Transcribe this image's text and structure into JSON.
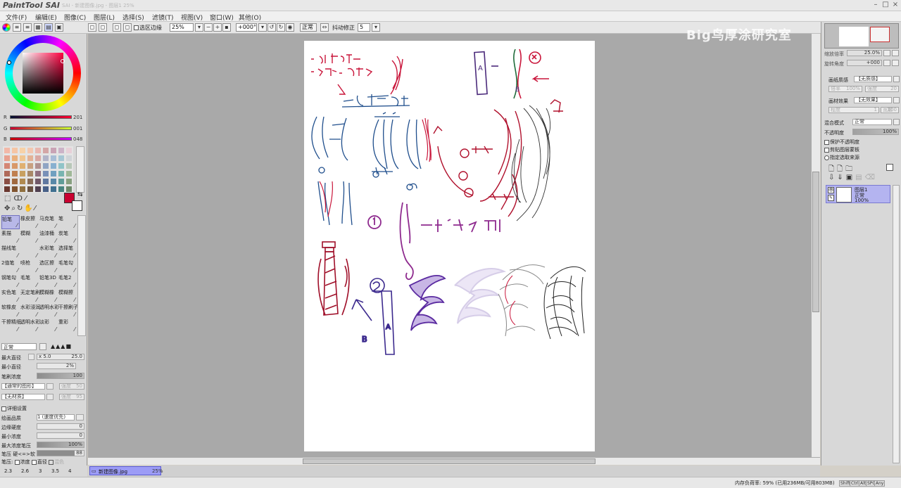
{
  "app": {
    "logo": "PaintTool SAI",
    "title": "SAI - 新建图像.jpg - 图层1 25%",
    "watermark": "Big鸟厚涂研究室"
  },
  "menu": [
    "文件(F)",
    "编辑(E)",
    "图像(C)",
    "图层(L)",
    "选择(S)",
    "滤镜(T)",
    "视图(V)",
    "窗口(W)",
    "其他(O)"
  ],
  "toolbar": {
    "selection_edge_label": "选区边缘",
    "zoom": "25%",
    "rotation": "+000°",
    "blend_mode": "正常",
    "stabilizer_label": "抖动修正",
    "stabilizer_value": "5"
  },
  "color": {
    "r_label": "R",
    "r_value": "201",
    "g_label": "G",
    "g_value": "001",
    "b_label": "B",
    "b_value": "048",
    "primary": "#c90130",
    "secondary": "#ffffff"
  },
  "palette": [
    "#f2b8a8",
    "#f5c5a5",
    "#f7d2a8",
    "#f3c7b0",
    "#e9b7b0",
    "#d4a6a6",
    "#c9a3b5",
    "#ccb3c8",
    "#e8d0d8",
    "#e8a090",
    "#eab07c",
    "#f0c590",
    "#e3b296",
    "#d9a8a3",
    "#b2b4c8",
    "#a8bdd6",
    "#a6c6d4",
    "#d0d4d8",
    "#d48674",
    "#d89868",
    "#e0b070",
    "#c8a080",
    "#b09090",
    "#8fa4c4",
    "#88b0d0",
    "#90c4c8",
    "#b8c8b8",
    "#b06a5a",
    "#c08050",
    "#c8a060",
    "#a88868",
    "#907080",
    "#7890b8",
    "#70a0c0",
    "#78b4b0",
    "#a0b898",
    "#8a4e44",
    "#a06a40",
    "#b08a50",
    "#886c58",
    "#705868",
    "#6078a0",
    "#5888a8",
    "#609c98",
    "#88a080",
    "#6a3830",
    "#805430",
    "#907040",
    "#685040",
    "#504050",
    "#486088",
    "#407090",
    "#488480",
    "#6c8868"
  ],
  "tools": [
    [
      "铅笔",
      "橡皮擦",
      "马克笔",
      "笔"
    ],
    [
      "素描",
      "模糊",
      "油漆桶",
      "炭笔"
    ],
    [
      "描线笔",
      "",
      "水彩笔",
      "选择笔"
    ],
    [
      "2值笔",
      "喷枪",
      "选区擦",
      "毛笔勾"
    ],
    [
      "钢笔勾",
      "毛笔",
      "铅笔3D",
      "毛笔2"
    ],
    [
      "实色笔",
      "无定笔刷",
      "模糊橡",
      "模糊擦"
    ],
    [
      "软橡皮",
      "水彩浸润",
      "透明水彩",
      "干擦刷子"
    ],
    [
      "干擦精细",
      "透明水彩",
      "淡彩",
      "重彩"
    ]
  ],
  "brush": {
    "mode": "正常",
    "max_size_label": "最大直径",
    "max_size_mult": "x 5.0",
    "max_size_value": "25.0",
    "min_size_label": "最小直径",
    "min_size_value": "2%",
    "density_label": "笔刷浓度",
    "density_value": "100",
    "shape": "【通常的图形】",
    "shape_strength": "强度",
    "shape_strength_value": "50",
    "texture": "【无材质】",
    "texture_strength": "强度",
    "texture_strength_value": "95",
    "detail_label": "详细设置",
    "quality_label": "绘画品质",
    "quality_value": "1 (速度优先)",
    "edge_label": "边缘硬度",
    "edge_value": "0",
    "min_density_label": "最小浓度",
    "min_density_value": "0",
    "max_pressure_label": "最大浓度笔压",
    "max_pressure_value": "100%",
    "pressure_label": "笔压 硬<=>软",
    "pressure_value": "88",
    "pressure2_label": "笔压:",
    "density_chk": "浓度",
    "size_chk": "直径",
    "blend_chk": "混色",
    "sizes": [
      "2.3",
      "2.6",
      "3",
      "3.5",
      "4"
    ]
  },
  "navigator": {
    "zoom_label": "缩放倍率",
    "zoom_value": "25.0%",
    "rotate_label": "旋转角度",
    "rotate_value": "+000"
  },
  "layer_props": {
    "paper_texture_label": "画纸质感",
    "paper_texture_value": "【无质感】",
    "paper_scale_label": "倍率",
    "paper_scale_value": "100%",
    "paper_strength_label": "强度",
    "paper_strength_value": "20",
    "effect_label": "画材效果",
    "effect_value": "【无效果】",
    "effect_degree_label": "程度",
    "effect_degree_value": "1",
    "effect_width_label": "宽度",
    "effect_width_value": "100",
    "blend_label": "混合模式",
    "blend_value": "正常",
    "opacity_label": "不透明度",
    "opacity_value": "100%",
    "protect_opacity": "保护不透明度",
    "clip_group": "剪贴图层蒙板",
    "selection_source": "指定选取来源"
  },
  "layer": {
    "name": "图层1",
    "mode": "正常",
    "opacity": "100%"
  },
  "tab": {
    "name": "新建图像.jpg",
    "zoom": "25%"
  },
  "status": {
    "memory": "内存负荷率: 59% (已用236MB/可用803MB)",
    "keys": [
      "Shift",
      "Ctrl",
      "Alt",
      "SPC",
      "Any"
    ]
  }
}
